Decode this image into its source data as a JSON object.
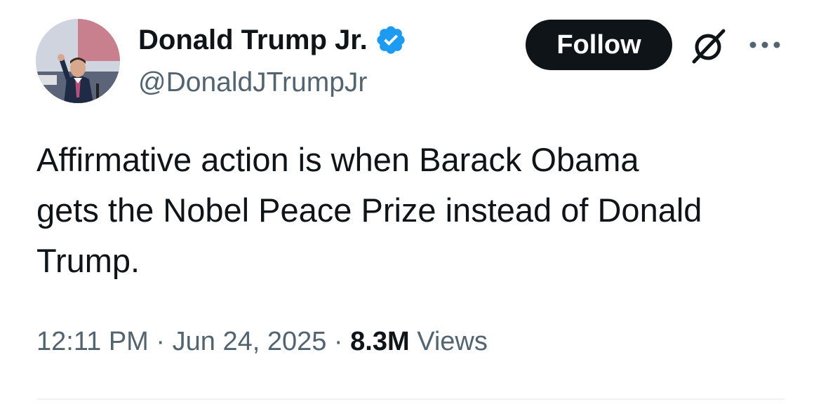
{
  "author": {
    "display_name": "Donald Trump Jr.",
    "handle": "@DonaldJTrumpJr",
    "verified": true,
    "avatar_icon": "profile-photo"
  },
  "actions": {
    "follow_label": "Follow",
    "grok_icon": "grok-icon",
    "more_icon": "more-options-icon"
  },
  "tweet": {
    "text": "Affirmative action is when Barack Obama\ngets the Nobel Peace Prize instead of Donald\nTrump."
  },
  "meta": {
    "time": "12:11 PM",
    "separator1": " · ",
    "date": "Jun 24, 2025",
    "separator2": " · ",
    "views_count": "8.3M",
    "views_label": " Views"
  },
  "colors": {
    "text_primary": "#0f1419",
    "text_secondary": "#536471",
    "verified_blue": "#1d9bf0",
    "button_bg": "#0f1419",
    "divider": "#eff3f4"
  }
}
